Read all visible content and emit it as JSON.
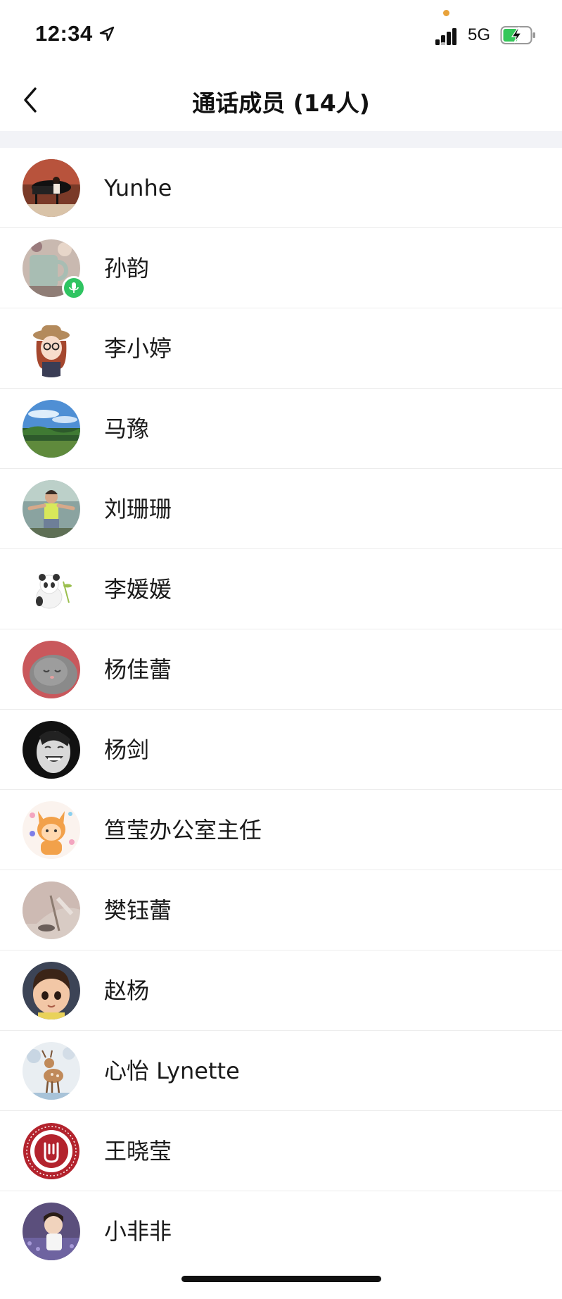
{
  "status_bar": {
    "time": "12:34",
    "network": "5G",
    "location_icon": "location-arrow-icon",
    "signal_icon": "cellular-signal-icon",
    "battery_icon": "battery-charging-icon",
    "battery_color": "#34c759"
  },
  "nav": {
    "back_icon": "chevron-left-icon",
    "title": "通话成员 (14人)"
  },
  "members": [
    {
      "name": "Yunhe",
      "avatar": "piano-photo"
    },
    {
      "name": "孙韵",
      "avatar": "mug-photo",
      "speaking": true
    },
    {
      "name": "李小婷",
      "avatar": "cartoon-girl-hat"
    },
    {
      "name": "马豫",
      "avatar": "landscape-photo"
    },
    {
      "name": "刘珊珊",
      "avatar": "woman-outdoor-photo"
    },
    {
      "name": "李媛媛",
      "avatar": "panda-cartoon"
    },
    {
      "name": "杨佳蕾",
      "avatar": "gray-cat-photo"
    },
    {
      "name": "杨剑",
      "avatar": "black-white-face-photo"
    },
    {
      "name": "笪莹办公室主任",
      "avatar": "orange-cartoon-character"
    },
    {
      "name": "樊钰蕾",
      "avatar": "pastel-photo"
    },
    {
      "name": "赵杨",
      "avatar": "cartoon-boy"
    },
    {
      "name": "心怡 Lynette",
      "avatar": "deer-illustration"
    },
    {
      "name": "王晓莹",
      "avatar": "red-seal-logo"
    },
    {
      "name": "小非非",
      "avatar": "child-flowers-photo"
    }
  ],
  "accent": {
    "speaking_badge": "#2fc461",
    "separator": "#f2f3f7"
  }
}
